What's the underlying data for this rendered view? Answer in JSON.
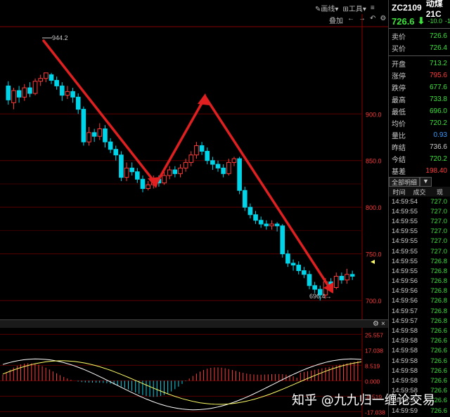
{
  "toolbar": {
    "draw_label": "画线",
    "tools_label": "工具",
    "overlay_label": "叠加"
  },
  "symbol": {
    "code": "ZC2109",
    "name": "动煤21C",
    "last": "726.6",
    "change": "-10.0",
    "change_pct": "-1"
  },
  "quote": [
    {
      "label": "卖价",
      "value": "726.6",
      "color": "#3be33b"
    },
    {
      "label": "买价",
      "value": "726.4",
      "color": "#3be33b"
    },
    {
      "label": "开盘",
      "value": "713.2",
      "color": "#3be33b"
    },
    {
      "label": "涨停",
      "value": "795.6",
      "color": "#ff3b3b"
    },
    {
      "label": "跌停",
      "value": "677.6",
      "color": "#3be33b"
    },
    {
      "label": "最高",
      "value": "733.8",
      "color": "#3be33b"
    },
    {
      "label": "最低",
      "value": "696.0",
      "color": "#3be33b"
    },
    {
      "label": "均价",
      "value": "720.2",
      "color": "#3be33b"
    },
    {
      "label": "量比",
      "value": "0.93",
      "color": "#3b9bff"
    },
    {
      "label": "昨结",
      "value": "736.6",
      "color": "#ccc"
    },
    {
      "label": "今结",
      "value": "720.2",
      "color": "#3be33b"
    },
    {
      "label": "基差",
      "value": "198.40",
      "color": "#ff3b3b"
    }
  ],
  "detail_tabs": [
    "全部明细",
    "▼"
  ],
  "tick_headers": [
    "时间",
    "成交",
    "现"
  ],
  "ticks": [
    {
      "time": "14:59:54",
      "price": "727.0"
    },
    {
      "time": "14:59:55",
      "price": "727.0"
    },
    {
      "time": "14:59:55",
      "price": "727.0"
    },
    {
      "time": "14:59:55",
      "price": "727.0"
    },
    {
      "time": "14:59:55",
      "price": "727.0"
    },
    {
      "time": "14:59:55",
      "price": "727.0"
    },
    {
      "time": "14:59:55",
      "price": "726.8"
    },
    {
      "time": "14:59:55",
      "price": "726.8"
    },
    {
      "time": "14:59:56",
      "price": "726.8"
    },
    {
      "time": "14:59:56",
      "price": "726.8"
    },
    {
      "time": "14:59:56",
      "price": "726.8"
    },
    {
      "time": "14:59:57",
      "price": "726.8"
    },
    {
      "time": "14:59:57",
      "price": "726.8"
    },
    {
      "time": "14:59:58",
      "price": "726.6"
    },
    {
      "time": "14:59:58",
      "price": "726.6"
    },
    {
      "time": "14:59:58",
      "price": "726.6"
    },
    {
      "time": "14:59:58",
      "price": "726.6"
    },
    {
      "time": "14:59:58",
      "price": "726.6"
    },
    {
      "time": "14:59:58",
      "price": "726.6"
    },
    {
      "time": "14:59:58",
      "price": "726.6"
    },
    {
      "time": "14:59:59",
      "price": "726.6"
    },
    {
      "time": "14:59:59",
      "price": "726.6"
    }
  ],
  "watermark": "知乎 @九九归一缠论交易",
  "chart_data": {
    "type": "candlestick",
    "price_axis_ticks": [
      900.0,
      850.0,
      800.0,
      750.0,
      700.0
    ],
    "ylim": [
      682,
      992
    ],
    "high_marker": "944.2",
    "low_marker": "696.4→",
    "candles": [
      [
        930,
        915,
        935,
        910
      ],
      [
        912,
        925,
        928,
        905
      ],
      [
        925,
        918,
        930,
        912
      ],
      [
        918,
        928,
        932,
        914
      ],
      [
        928,
        922,
        934,
        918
      ],
      [
        922,
        935,
        938,
        920
      ],
      [
        935,
        938,
        942,
        930
      ],
      [
        938,
        944,
        944,
        934
      ],
      [
        942,
        936,
        944,
        932
      ],
      [
        936,
        930,
        940,
        926
      ],
      [
        930,
        920,
        934,
        914
      ],
      [
        920,
        924,
        930,
        916
      ],
      [
        924,
        918,
        928,
        912
      ],
      [
        918,
        905,
        922,
        900
      ],
      [
        905,
        870,
        908,
        866
      ],
      [
        870,
        880,
        886,
        866
      ],
      [
        880,
        876,
        884,
        870
      ],
      [
        876,
        884,
        890,
        872
      ],
      [
        884,
        870,
        888,
        864
      ],
      [
        870,
        862,
        874,
        858
      ],
      [
        862,
        856,
        866,
        850
      ],
      [
        856,
        832,
        860,
        828
      ],
      [
        832,
        842,
        848,
        828
      ],
      [
        842,
        838,
        848,
        834
      ],
      [
        838,
        830,
        842,
        826
      ],
      [
        830,
        820,
        834,
        816
      ],
      [
        820,
        824,
        828,
        818
      ],
      [
        824,
        830,
        834,
        820
      ],
      [
        830,
        826,
        834,
        822
      ],
      [
        826,
        834,
        838,
        824
      ],
      [
        834,
        840,
        844,
        830
      ],
      [
        840,
        836,
        844,
        832
      ],
      [
        836,
        842,
        846,
        832
      ],
      [
        842,
        848,
        852,
        838
      ],
      [
        848,
        856,
        860,
        844
      ],
      [
        856,
        866,
        870,
        852
      ],
      [
        866,
        860,
        870,
        856
      ],
      [
        860,
        850,
        864,
        846
      ],
      [
        850,
        846,
        854,
        840
      ],
      [
        846,
        842,
        850,
        838
      ],
      [
        842,
        836,
        846,
        832
      ],
      [
        836,
        848,
        852,
        834
      ],
      [
        848,
        852,
        854,
        844
      ],
      [
        852,
        818,
        854,
        814
      ],
      [
        818,
        800,
        822,
        796
      ],
      [
        800,
        792,
        804,
        788
      ],
      [
        792,
        786,
        796,
        782
      ],
      [
        786,
        782,
        790,
        778
      ],
      [
        782,
        780,
        786,
        776
      ],
      [
        780,
        782,
        786,
        776
      ],
      [
        782,
        780,
        784,
        774
      ],
      [
        780,
        750,
        782,
        746
      ],
      [
        750,
        740,
        754,
        736
      ],
      [
        740,
        738,
        744,
        732
      ],
      [
        738,
        732,
        742,
        728
      ],
      [
        732,
        728,
        736,
        724
      ],
      [
        728,
        716,
        732,
        712
      ],
      [
        716,
        712,
        720,
        708
      ],
      [
        712,
        706,
        716,
        700
      ],
      [
        706,
        720,
        724,
        702
      ],
      [
        720,
        714,
        724,
        710
      ],
      [
        714,
        726,
        730,
        712
      ],
      [
        726,
        722,
        730,
        718
      ],
      [
        722,
        728,
        734,
        718
      ],
      [
        728,
        726,
        732,
        722
      ]
    ],
    "macd": {
      "ticks": [
        25.557,
        17.038,
        8.519,
        0.0,
        -8.519,
        -17.038
      ]
    }
  },
  "colors": {
    "up": "#ff3b3b",
    "down": "#00d4e8",
    "trend_arrow": "#e02020",
    "grid": "#5a0000",
    "axis_text": "#ff3b3b"
  }
}
